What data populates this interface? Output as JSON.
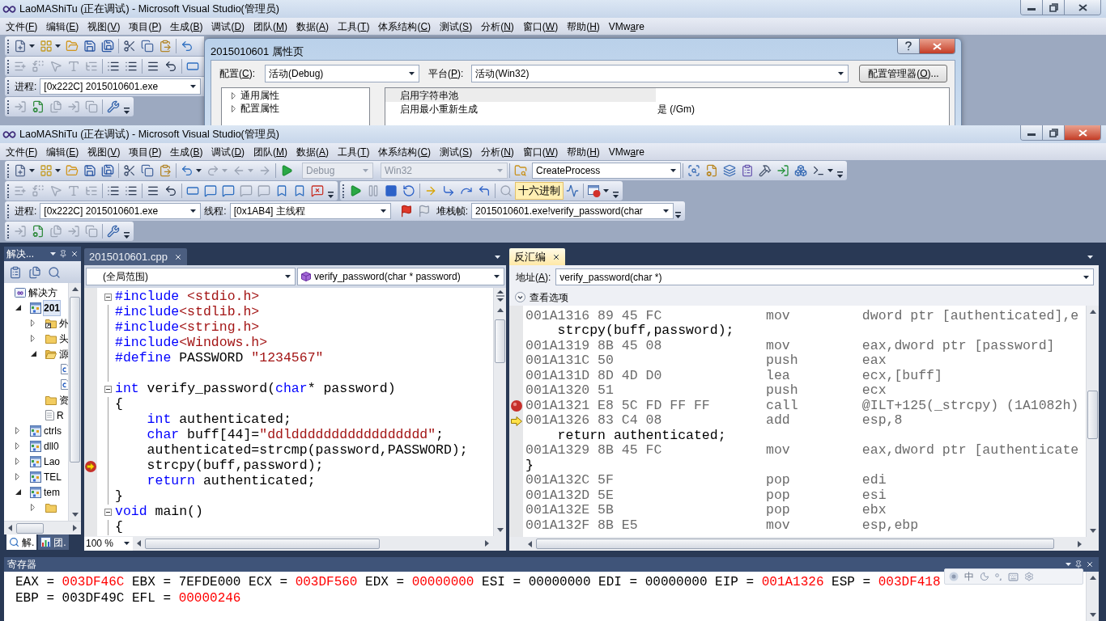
{
  "back_window": {
    "title": "LaoMAShiTu (正在调试) - Microsoft Visual Studio(管理员)",
    "active": false,
    "menu": [
      [
        "文件(",
        "F",
        ")"
      ],
      [
        "编辑(",
        "E",
        ")"
      ],
      [
        "视图(",
        "V",
        ")"
      ],
      [
        "项目(",
        "P",
        ")"
      ],
      [
        "生成(",
        "B",
        ")"
      ],
      [
        "调试(",
        "D",
        ")"
      ],
      [
        "团队(",
        "M",
        ")"
      ],
      [
        "数据(",
        "A",
        ")"
      ],
      [
        "工具(",
        "T",
        ")"
      ],
      [
        "体系结构(",
        "C",
        ")"
      ],
      [
        "测试(",
        "S",
        ")"
      ],
      [
        "分析(",
        "N",
        ")"
      ],
      [
        "窗口(",
        "W",
        ")"
      ],
      [
        "帮助(",
        "H",
        ")"
      ],
      [
        "VMw",
        "a",
        "re"
      ]
    ],
    "process": {
      "label": "进程:",
      "value": "[0x222C] 2015010601.exe"
    },
    "dialog": {
      "title": "2015010601 属性页",
      "configuration": {
        "label": [
          "配置(",
          "C",
          "):"
        ],
        "value": "活动(Debug)"
      },
      "platform": {
        "label": [
          "平台(",
          "P",
          "):"
        ],
        "value": "活动(Win32)"
      },
      "manager_button": [
        "配置管理器(",
        "O",
        ")..."
      ],
      "tree": [
        {
          "label": "通用属性",
          "expanded": false
        },
        {
          "label": "配置属性",
          "expanded": false
        }
      ],
      "properties": [
        {
          "name": "启用字符串池",
          "selected": true
        },
        {
          "name": "启用最小重新生成",
          "value": "是 (/Gm)",
          "selected": false
        }
      ]
    }
  },
  "front_window": {
    "title": "LaoMAShiTu (正在调试) - Microsoft Visual Studio(管理员)",
    "active": true,
    "menu": [
      [
        "文件(",
        "F",
        ")"
      ],
      [
        "编辑(",
        "E",
        ")"
      ],
      [
        "视图(",
        "V",
        ")"
      ],
      [
        "项目(",
        "P",
        ")"
      ],
      [
        "生成(",
        "B",
        ")"
      ],
      [
        "调试(",
        "D",
        ")"
      ],
      [
        "团队(",
        "M",
        ")"
      ],
      [
        "数据(",
        "A",
        ")"
      ],
      [
        "工具(",
        "T",
        ")"
      ],
      [
        "体系结构(",
        "C",
        ")"
      ],
      [
        "测试(",
        "S",
        ")"
      ],
      [
        "分析(",
        "N",
        ")"
      ],
      [
        "窗口(",
        "W",
        ")"
      ],
      [
        "帮助(",
        "H",
        ")"
      ],
      [
        "VMw",
        "a",
        "re"
      ]
    ],
    "toolbar": {
      "configuration": {
        "value": "Debug",
        "disabled": true
      },
      "platform": {
        "value": "Win32",
        "disabled": true
      },
      "find": {
        "value": "CreateProcess"
      },
      "hex_toggle": {
        "label": "十六进制",
        "selected": true
      }
    },
    "debug_location": {
      "process": {
        "label": "进程:",
        "value": "[0x222C] 2015010601.exe"
      },
      "thread": {
        "label": "线程:",
        "value": "[0x1AB4] 主线程"
      },
      "stack_frame": {
        "label": "堆栈帧:",
        "value": "2015010601.exe!verify_password(char"
      }
    }
  },
  "solution_explorer": {
    "title": "解决...",
    "tree": [
      {
        "label": "解决方",
        "kind": "solution",
        "selected": false,
        "children": [
          {
            "label": "201",
            "kind": "project",
            "expanded": true,
            "selected": true,
            "startup": true,
            "children": [
              {
                "label": "外",
                "kind": "external",
                "expanded": false,
                "selected": false
              },
              {
                "label": "头",
                "kind": "folder",
                "expanded": false,
                "selected": false
              },
              {
                "label": "源",
                "kind": "folder",
                "expanded": true,
                "selected": false,
                "children": [
                  {
                    "kind": "cpp",
                    "selected": false
                  },
                  {
                    "kind": "cpp",
                    "selected": false
                  }
                ]
              },
              {
                "label": "资",
                "kind": "folder",
                "selected": false
              },
              {
                "label": "R",
                "kind": "file",
                "selected": false
              }
            ]
          },
          {
            "label": "ctrls",
            "kind": "project",
            "expanded": false,
            "selected": false,
            "startup": false
          },
          {
            "label": "dll0",
            "kind": "project",
            "expanded": false,
            "selected": false,
            "startup": false
          },
          {
            "label": "Lao",
            "kind": "project",
            "expanded": false,
            "selected": false,
            "startup": false
          },
          {
            "label": "TEL",
            "kind": "project",
            "expanded": false,
            "selected": false,
            "startup": false
          },
          {
            "label": "tem",
            "kind": "project",
            "expanded": true,
            "selected": false,
            "startup": false,
            "children": [
              {
                "kind": "folder",
                "expanded": false,
                "selected": false
              }
            ]
          }
        ]
      }
    ],
    "tabs": [
      {
        "label": "解.",
        "selected": true
      },
      {
        "label": "团.",
        "selected": false
      }
    ]
  },
  "editor": {
    "tab": {
      "label": "2015010601.cpp",
      "selected": false
    },
    "scope": "(全局范围)",
    "member": "verify_password(char * password)",
    "zoom": "100 %",
    "lines": [
      {
        "segments": [
          {
            "text": "#include",
            "kind": "keyword"
          },
          {
            "text": " <stdio.h>",
            "kind": "string"
          }
        ],
        "fold_start": true,
        "breakpoint": false,
        "current": false
      },
      {
        "segments": [
          {
            "text": "#include",
            "kind": "keyword"
          },
          {
            "text": "<stdlib.h>",
            "kind": "string"
          }
        ],
        "fold_start": false,
        "breakpoint": false,
        "current": false
      },
      {
        "segments": [
          {
            "text": "#include",
            "kind": "keyword"
          },
          {
            "text": "<string.h>",
            "kind": "string"
          }
        ],
        "fold_start": false,
        "breakpoint": false,
        "current": false
      },
      {
        "segments": [
          {
            "text": "#include",
            "kind": "keyword"
          },
          {
            "text": "<Windows.h>",
            "kind": "string"
          }
        ],
        "fold_start": false,
        "breakpoint": false,
        "current": false
      },
      {
        "segments": [
          {
            "text": "#define",
            "kind": "keyword"
          },
          {
            "text": " PASSWORD ",
            "kind": "plain"
          },
          {
            "text": "\"1234567\"",
            "kind": "string"
          }
        ],
        "fold_start": false,
        "breakpoint": false,
        "current": false
      },
      {
        "fold_start": false,
        "breakpoint": false,
        "current": false
      },
      {
        "segments": [
          {
            "text": "int",
            "kind": "keyword"
          },
          {
            "text": " verify_password(",
            "kind": "plain"
          },
          {
            "text": "char",
            "kind": "keyword"
          },
          {
            "text": "* password)",
            "kind": "plain"
          }
        ],
        "fold_start": true,
        "breakpoint": false,
        "current": false
      },
      {
        "segments": [
          {
            "text": "{",
            "kind": "plain"
          }
        ],
        "fold_start": false,
        "breakpoint": false,
        "current": false
      },
      {
        "segments": [
          {
            "text": "    int",
            "kind": "keyword"
          },
          {
            "text": " authenticated;",
            "kind": "plain"
          }
        ],
        "fold_start": false,
        "breakpoint": false,
        "current": false
      },
      {
        "segments": [
          {
            "text": "    char",
            "kind": "keyword"
          },
          {
            "text": " buff[44]=",
            "kind": "plain"
          },
          {
            "text": "\"ddlddddddddddddddddd\"",
            "kind": "string"
          },
          {
            "text": ";",
            "kind": "plain"
          }
        ],
        "fold_start": false,
        "breakpoint": false,
        "current": false
      },
      {
        "segments": [
          {
            "text": "    authenticated=strcmp(password,PASSWORD);",
            "kind": "plain"
          }
        ],
        "fold_start": false,
        "breakpoint": false,
        "current": false
      },
      {
        "segments": [
          {
            "text": "    strcpy(buff,password);",
            "kind": "plain"
          }
        ],
        "fold_start": false,
        "breakpoint": true,
        "current": true
      },
      {
        "segments": [
          {
            "text": "    return",
            "kind": "keyword"
          },
          {
            "text": " authenticated;",
            "kind": "plain"
          }
        ],
        "fold_start": false,
        "breakpoint": false,
        "current": false
      },
      {
        "segments": [
          {
            "text": "}",
            "kind": "plain"
          }
        ],
        "fold_start": false,
        "breakpoint": false,
        "current": false
      },
      {
        "segments": [
          {
            "text": "void",
            "kind": "keyword"
          },
          {
            "text": " main()",
            "kind": "plain"
          }
        ],
        "fold_start": true,
        "breakpoint": false,
        "current": false
      },
      {
        "segments": [
          {
            "text": "{",
            "kind": "plain"
          }
        ],
        "fold_start": false,
        "breakpoint": false,
        "current": false
      }
    ]
  },
  "disassembly": {
    "tab": {
      "label": "反汇编",
      "selected": true
    },
    "address": {
      "label": [
        "地址(",
        "A",
        "):"
      ],
      "value": "verify_password(char *)"
    },
    "view_options": {
      "label": "查看选项",
      "expanded": false
    },
    "lines": [
      {
        "kind": "instruction",
        "address": "001A1316",
        "bytes": "89 45 FC",
        "mnemonic": "mov",
        "operands": "dword ptr [authenticated],e",
        "breakpoint": false,
        "current": false
      },
      {
        "kind": "source",
        "text": "    strcpy(buff,password);",
        "breakpoint": false,
        "current": false
      },
      {
        "kind": "instruction",
        "address": "001A1319",
        "bytes": "8B 45 08",
        "mnemonic": "mov",
        "operands": "eax,dword ptr [password]",
        "breakpoint": false,
        "current": false
      },
      {
        "kind": "instruction",
        "address": "001A131C",
        "bytes": "50",
        "mnemonic": "push",
        "operands": "eax",
        "breakpoint": false,
        "current": false
      },
      {
        "kind": "instruction",
        "address": "001A131D",
        "bytes": "8D 4D D0",
        "mnemonic": "lea",
        "operands": "ecx,[buff]",
        "breakpoint": false,
        "current": false
      },
      {
        "kind": "instruction",
        "address": "001A1320",
        "bytes": "51",
        "mnemonic": "push",
        "operands": "ecx",
        "breakpoint": false,
        "current": false
      },
      {
        "kind": "instruction",
        "address": "001A1321",
        "bytes": "E8 5C FD FF FF",
        "mnemonic": "call",
        "operands": "@ILT+125(_strcpy) (1A1082h)",
        "breakpoint": true,
        "current": false
      },
      {
        "kind": "instruction",
        "address": "001A1326",
        "bytes": "83 C4 08",
        "mnemonic": "add",
        "operands": "esp,8",
        "breakpoint": false,
        "current": true
      },
      {
        "kind": "source",
        "text": "    return authenticated;",
        "breakpoint": false,
        "current": false
      },
      {
        "kind": "instruction",
        "address": "001A1329",
        "bytes": "8B 45 FC",
        "mnemonic": "mov",
        "operands": "eax,dword ptr [authenticate",
        "breakpoint": false,
        "current": false
      },
      {
        "kind": "source",
        "text": "}",
        "breakpoint": false,
        "current": false
      },
      {
        "kind": "instruction",
        "address": "001A132C",
        "bytes": "5F",
        "mnemonic": "pop",
        "operands": "edi",
        "breakpoint": false,
        "current": false
      },
      {
        "kind": "instruction",
        "address": "001A132D",
        "bytes": "5E",
        "mnemonic": "pop",
        "operands": "esi",
        "breakpoint": false,
        "current": false
      },
      {
        "kind": "instruction",
        "address": "001A132E",
        "bytes": "5B",
        "mnemonic": "pop",
        "operands": "ebx",
        "breakpoint": false,
        "current": false
      },
      {
        "kind": "instruction",
        "address": "001A132F",
        "bytes": "8B E5",
        "mnemonic": "mov",
        "operands": "esp,ebp",
        "breakpoint": false,
        "current": false
      }
    ]
  },
  "registers": {
    "title": "寄存器",
    "rows": [
      [
        {
          "label": "EAX =",
          "value": "003DF46C",
          "changed": true
        },
        {
          "label": "EBX =",
          "value": "7EFDE000",
          "changed": false
        },
        {
          "label": "ECX =",
          "value": "003DF560",
          "changed": true
        },
        {
          "label": "EDX =",
          "value": "00000000",
          "changed": true
        },
        {
          "label": "ESI =",
          "value": "00000000",
          "changed": false
        },
        {
          "label": "EDI =",
          "value": "00000000",
          "changed": false
        },
        {
          "label": "EIP =",
          "value": "001A1326",
          "changed": true
        },
        {
          "label": "ESP =",
          "value": "003DF418",
          "changed": true
        }
      ],
      [
        {
          "label": "EBP =",
          "value": "003DF49C",
          "changed": false
        },
        {
          "label": "EFL =",
          "value": "00000246",
          "changed": true
        }
      ]
    ]
  },
  "ime_toolbar": {
    "mode": "中"
  }
}
